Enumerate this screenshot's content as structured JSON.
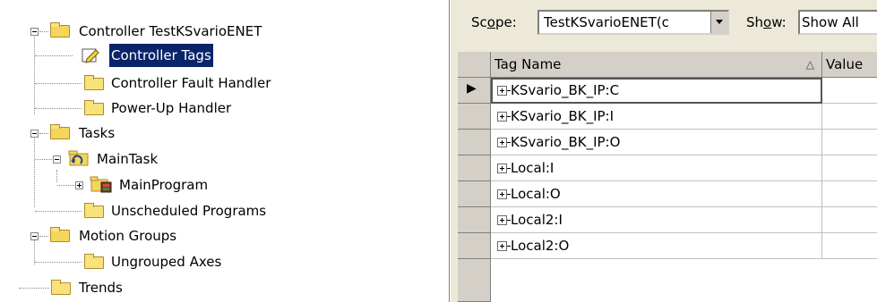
{
  "tree": {
    "items": [
      {
        "label": "Controller TestKSvarioENET",
        "icon": "folder-open-icon",
        "level": 0,
        "toggle": "minus"
      },
      {
        "label": "Controller Tags",
        "icon": "controller-tags-icon",
        "level": 1,
        "selected": true
      },
      {
        "label": "Controller Fault Handler",
        "icon": "folder-icon",
        "level": 1
      },
      {
        "label": "Power-Up Handler",
        "icon": "folder-icon",
        "level": 1
      },
      {
        "label": "Tasks",
        "icon": "folder-open-icon",
        "level": 0,
        "toggle": "minus"
      },
      {
        "label": "MainTask",
        "icon": "task-icon",
        "level": 1,
        "toggle": "minus"
      },
      {
        "label": "MainProgram",
        "icon": "program-icon",
        "level": 2,
        "toggle": "plus"
      },
      {
        "label": "Unscheduled Programs",
        "icon": "folder-icon",
        "level": 1
      },
      {
        "label": "Motion Groups",
        "icon": "folder-open-icon",
        "level": 0,
        "toggle": "minus"
      },
      {
        "label": "Ungrouped Axes",
        "icon": "folder-icon",
        "level": 1
      },
      {
        "label": "Trends",
        "icon": "folder-icon",
        "level": 0
      }
    ]
  },
  "toolbar": {
    "scope_label_pre": "Sc",
    "scope_label_u": "o",
    "scope_label_post": "pe:",
    "scope_value": "TestKSvarioENET(c",
    "show_label_pre": "Sh",
    "show_label_u": "o",
    "show_label_post": "w:",
    "show_value": "Show All"
  },
  "grid": {
    "columns": {
      "tag_name": "Tag Name",
      "sort_glyph": "△",
      "value": "Value"
    },
    "current_row_glyph": "▶",
    "rows": [
      {
        "tag": "KSvario_BK_IP:C",
        "current": true
      },
      {
        "tag": "KSvario_BK_IP:I"
      },
      {
        "tag": "KSvario_BK_IP:O"
      },
      {
        "tag": "Local:I"
      },
      {
        "tag": "Local:O"
      },
      {
        "tag": "Local2:I"
      },
      {
        "tag": "Local2:O"
      }
    ]
  },
  "colors": {
    "selection": "#0a246a",
    "folder": "#f8e27a",
    "chrome": "#d4d0c8"
  }
}
